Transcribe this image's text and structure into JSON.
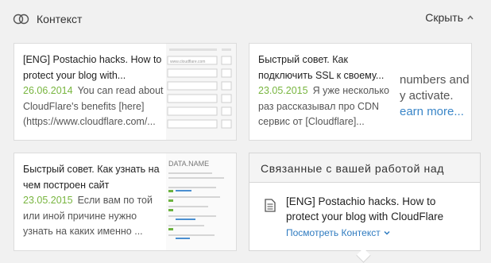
{
  "header": {
    "title": "Контекст",
    "hide_label": "Скрыть",
    "icon": "context-rings-icon"
  },
  "cards": [
    {
      "title": "[ENG] Postachio hacks. How to protect your blog with...",
      "title_line1": "[ENG] Postachio hacks. How to",
      "title_line2": "protect your blog with...",
      "date": "26.06.2014",
      "snippet_line1": "You can read about",
      "snippet_line2": "CloudFlare's benefits [here]",
      "snippet_line3": "(https://www.cloudflare.com/...",
      "thumb_text": "www.cloudflare.com"
    },
    {
      "title_line1": "Быстрый совет. Как",
      "title_line2": "подключить SSL к своему...",
      "date": "23.05.2015",
      "snippet_line1": "Я уже несколько",
      "snippet_line2": "раз рассказывал про CDN",
      "snippet_line3": "сервис от [Cloudflare]...",
      "thumb_line1": "numbers and",
      "thumb_line2": "y activate.",
      "thumb_line3": "earn more..."
    },
    {
      "title_line1": "Быстрый совет. Как узнать на",
      "title_line2": "чем построен сайт",
      "date": "23.05.2015",
      "snippet_line1": "Если вам по той",
      "snippet_line2": "или иной причине нужно",
      "snippet_line3": "узнать на каких именно ...",
      "thumb_text": "DATA.NAME"
    }
  ],
  "related": {
    "heading": "Связанные с вашей работой над",
    "doc_title": "[ENG] Postachio hacks. How to protect your blog with CloudFlare",
    "link_label": "Посмотреть Контекст",
    "doc_icon": "document-icon"
  },
  "colors": {
    "date": "#78b53f",
    "link": "#2f7bc0",
    "background": "#f1f1f1"
  }
}
